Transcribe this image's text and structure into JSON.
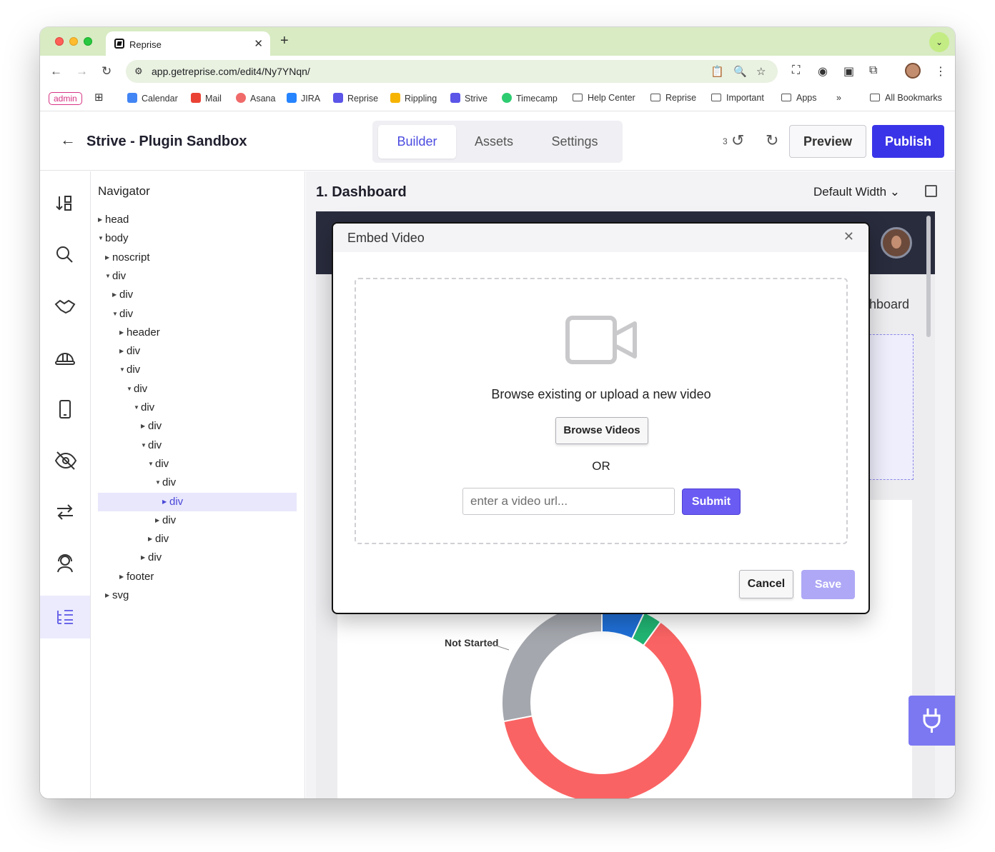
{
  "browser": {
    "tab_title": "Reprise",
    "tab_close": "✕",
    "new_tab": "+",
    "url": "app.getreprise.com/edit4/Ny7YNqn/",
    "bookmarks": {
      "admin": "admin",
      "items": [
        "Calendar",
        "Mail",
        "Asana",
        "JIRA",
        "Reprise",
        "Rippling",
        "Strive",
        "Timecamp",
        "Help Center",
        "Reprise",
        "Important",
        "Apps"
      ],
      "overflow": "»",
      "all_bookmarks": "All Bookmarks"
    }
  },
  "app": {
    "title": "Strive - Plugin Sandbox",
    "tabs": [
      "Builder",
      "Assets",
      "Settings"
    ],
    "active_tab": "Builder",
    "undo_count": "3",
    "preview_label": "Preview",
    "publish_label": "Publish"
  },
  "rail": {
    "icons": [
      "sort-icon",
      "search-icon",
      "handshake-icon",
      "hard-hat-icon",
      "mobile-icon",
      "eye-slash-icon",
      "swap-icon",
      "support-agent-icon",
      "tree-list-icon"
    ],
    "active": "tree-list-icon"
  },
  "navigator": {
    "title": "Navigator",
    "nodes": [
      {
        "label": "head",
        "depth": 0,
        "expanded": false
      },
      {
        "label": "body",
        "depth": 0,
        "expanded": true
      },
      {
        "label": "noscript",
        "depth": 1,
        "expanded": false
      },
      {
        "label": "div",
        "depth": 1,
        "expanded": true
      },
      {
        "label": "div",
        "depth": 2,
        "expanded": false
      },
      {
        "label": "div",
        "depth": 2,
        "expanded": true
      },
      {
        "label": "header",
        "depth": 3,
        "expanded": false
      },
      {
        "label": "div",
        "depth": 3,
        "expanded": false
      },
      {
        "label": "div",
        "depth": 3,
        "expanded": true
      },
      {
        "label": "div",
        "depth": 4,
        "expanded": true
      },
      {
        "label": "div",
        "depth": 5,
        "expanded": true
      },
      {
        "label": "div",
        "depth": 6,
        "expanded": false
      },
      {
        "label": "div",
        "depth": 6,
        "expanded": true
      },
      {
        "label": "div",
        "depth": 7,
        "expanded": true
      },
      {
        "label": "div",
        "depth": 8,
        "expanded": true
      },
      {
        "label": "div",
        "depth": 9,
        "expanded": false,
        "selected": true
      },
      {
        "label": "div",
        "depth": 8,
        "expanded": false
      },
      {
        "label": "div",
        "depth": 7,
        "expanded": false
      },
      {
        "label": "div",
        "depth": 6,
        "expanded": false
      },
      {
        "label": "footer",
        "depth": 3,
        "expanded": false
      },
      {
        "label": "svg",
        "depth": 1,
        "expanded": false
      }
    ]
  },
  "canvas": {
    "page_title": "1. Dashboard",
    "width_select": "Default Width",
    "preview_partial_title": "hboard",
    "chart_label": "Not Started",
    "donut": [
      {
        "label": "Not Started",
        "fraction": 0.28,
        "color": "#a4a7ad"
      },
      {
        "label": "",
        "fraction": 0.07,
        "color": "#1f6fd6"
      },
      {
        "label": "",
        "fraction": 0.03,
        "color": "#21b573"
      },
      {
        "label": "",
        "fraction": 0.62,
        "color": "#fa6363"
      }
    ]
  },
  "modal": {
    "title": "Embed Video",
    "close": "✕",
    "prompt": "Browse existing or upload a new video",
    "browse_label": "Browse Videos",
    "or_label": "OR",
    "url_placeholder": "enter a video url...",
    "submit_label": "Submit",
    "cancel_label": "Cancel",
    "save_label": "Save"
  },
  "colors": {
    "accent": "#3a34e8",
    "submit": "#6a5cf3",
    "save_disabled": "#aea8f6",
    "tabstrip": "#d8ebc3"
  }
}
